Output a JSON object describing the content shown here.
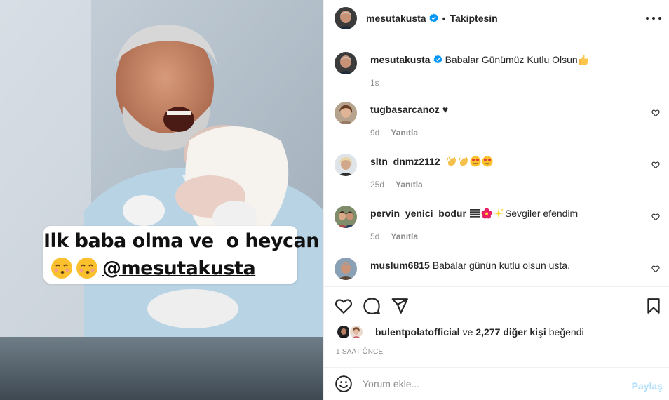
{
  "header": {
    "username": "mesutakusta",
    "separator": "•",
    "follow_status": "Takiptesin"
  },
  "media": {
    "caption_line1": "Ilk baba olma ve  o heycan",
    "caption_handle": "@mesutakusta",
    "caption_emoji": "kissing-face-with-smiling-eyes"
  },
  "caption": {
    "username": "mesutakusta",
    "text": "Babalar Günümüz Kutlu Olsun",
    "time": "1s"
  },
  "comments": [
    {
      "username": "tugbasarcanoz",
      "text": "♥",
      "time": "9d",
      "reply_label": "Yanıtla"
    },
    {
      "username": "sltn_dnmz2112",
      "text": "",
      "time": "25d",
      "reply_label": "Yanıtla"
    },
    {
      "username": "pervin_yenici_bodur",
      "text": "Sevgiler efendim",
      "time": "5d",
      "reply_label": "Yanıtla"
    },
    {
      "username": "muslum6815",
      "text": "Babalar günün kutlu olsun usta.",
      "time": "",
      "reply_label": ""
    }
  ],
  "likes": {
    "first_liker": "bulentpolatofficial",
    "connector": "ve",
    "others": "2,277 diğer kişi",
    "suffix": "beğendi"
  },
  "timestamp": "1 SAAT ÖNCE",
  "add_comment": {
    "placeholder": "Yorum ekle...",
    "post_label": "Paylaş"
  },
  "colors": {
    "verified_blue": "#0095f6",
    "post_disabled": "#b2dffc",
    "muted_text": "#8e8e8e"
  }
}
